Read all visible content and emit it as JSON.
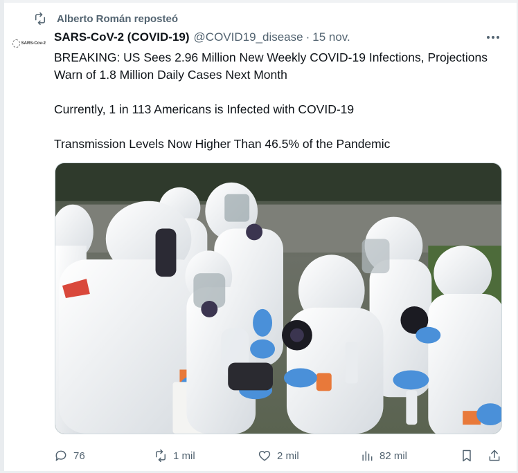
{
  "repost": {
    "icon": "repost-icon",
    "text": "Alberto Román reposteó"
  },
  "author": {
    "avatar_text": "SARS-Cov-2",
    "name": "SARS-CoV-2 (COVID-19)",
    "handle": "@COVID19_disease",
    "separator": "·",
    "date": "15 nov."
  },
  "post": {
    "paragraphs": [
      "BREAKING: US Sees 2.96 Million New Weekly COVID-19 Infections, Projections Warn of 1.8 Million Daily Cases Next Month",
      "Currently, 1 in 113 Americans is Infected with COVID-19",
      "Transmission Levels Now Higher Than 46.5% of the Pandemic"
    ]
  },
  "media": {
    "kind": "photo",
    "colors": {
      "suit": "#f2f4f6",
      "glove": "#4a90d9",
      "tape": "#e8793a",
      "bg": "#4f5a4c"
    }
  },
  "actions": {
    "reply": {
      "icon": "reply-icon",
      "count": "76"
    },
    "repost": {
      "icon": "repost-icon",
      "count": "1 mil"
    },
    "like": {
      "icon": "heart-icon",
      "count": "2 mil"
    },
    "views": {
      "icon": "views-chart-icon",
      "count": "82 mil"
    },
    "bookmark": {
      "icon": "bookmark-icon"
    },
    "share": {
      "icon": "share-icon"
    }
  },
  "colors": {
    "text": "#0f1419",
    "muted": "#536471",
    "border": "#cfd9de"
  }
}
